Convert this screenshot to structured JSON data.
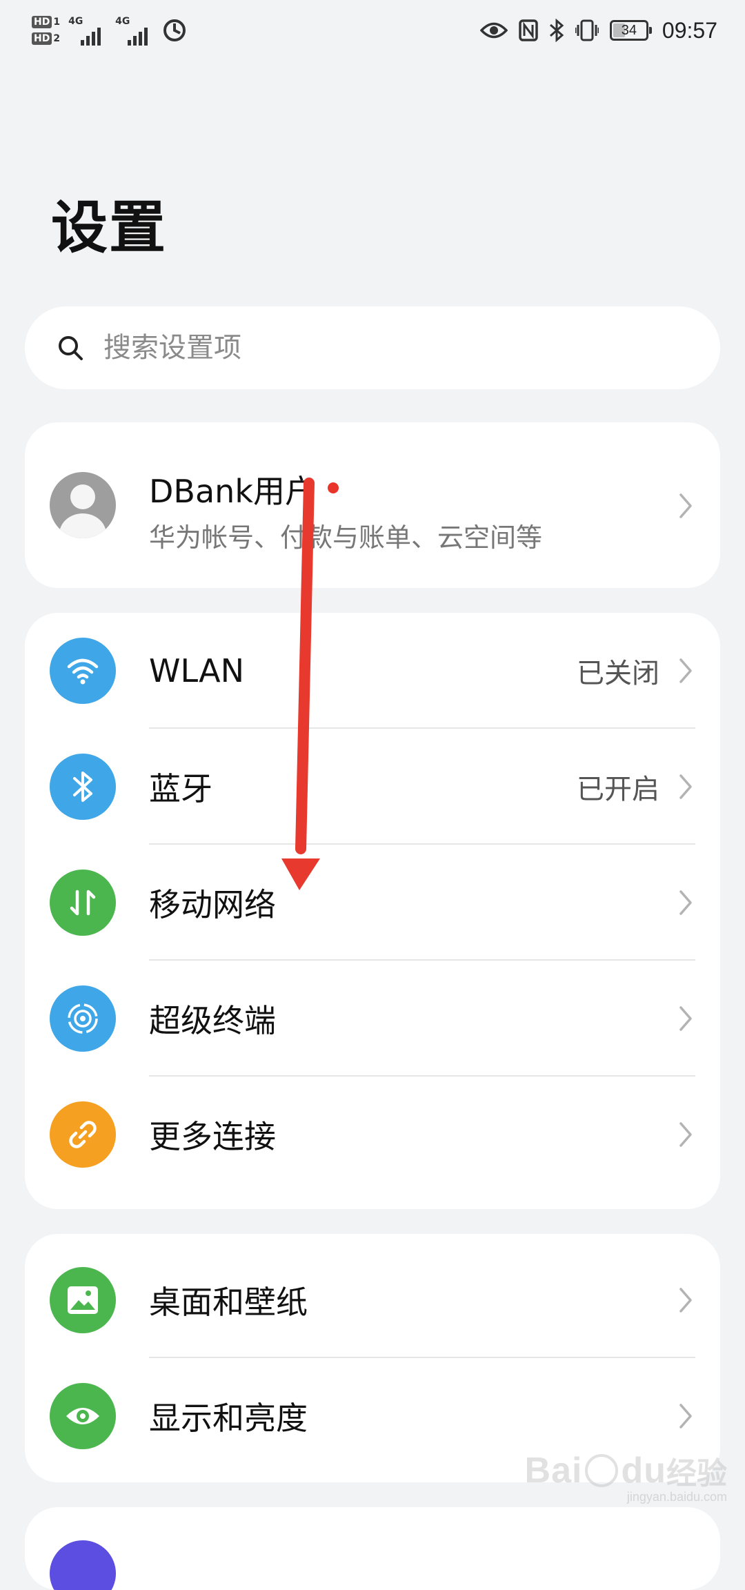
{
  "status_bar": {
    "sim1_badge": "HD",
    "sim1_num": "1",
    "sim2_badge": "HD",
    "sim2_num": "2",
    "signal1_label": "4G",
    "signal2_label": "4G",
    "battery_level": "34",
    "time": "09:57",
    "icons": [
      "hd-sim-icon",
      "signal-icon",
      "data-saver-icon",
      "eye-comfort-icon",
      "nfc-icon",
      "bluetooth-icon",
      "vibrate-icon",
      "battery-icon"
    ]
  },
  "page": {
    "title": "设置"
  },
  "search": {
    "placeholder": "搜索设置项"
  },
  "account": {
    "name": "DBank用户",
    "subtitle": "华为帐号、付款与账单、云空间等"
  },
  "connections": [
    {
      "label": "WLAN",
      "value": "已关闭",
      "icon": "wifi-icon",
      "color": "#3fa7e8"
    },
    {
      "label": "蓝牙",
      "value": "已开启",
      "icon": "bluetooth-icon",
      "color": "#3fa7e8"
    },
    {
      "label": "移动网络",
      "value": "",
      "icon": "mobile-network-icon",
      "color": "#4cb64e"
    },
    {
      "label": "超级终端",
      "value": "",
      "icon": "super-device-icon",
      "color": "#3fa7e8"
    },
    {
      "label": "更多连接",
      "value": "",
      "icon": "link-icon",
      "color": "#f5a020"
    }
  ],
  "display": [
    {
      "label": "桌面和壁纸",
      "icon": "wallpaper-icon",
      "color": "#4cb64e"
    },
    {
      "label": "显示和亮度",
      "icon": "eye-icon",
      "color": "#4cb64e"
    }
  ],
  "watermark": {
    "brand": "Bai",
    "brand2": "du",
    "jingyan": "经验",
    "url": "jingyan.baidu.com"
  },
  "colors": {
    "background": "#f1f3f5",
    "card": "#ffffff",
    "annotation_arrow": "#e8392e",
    "notify_dot": "#e8342b"
  }
}
